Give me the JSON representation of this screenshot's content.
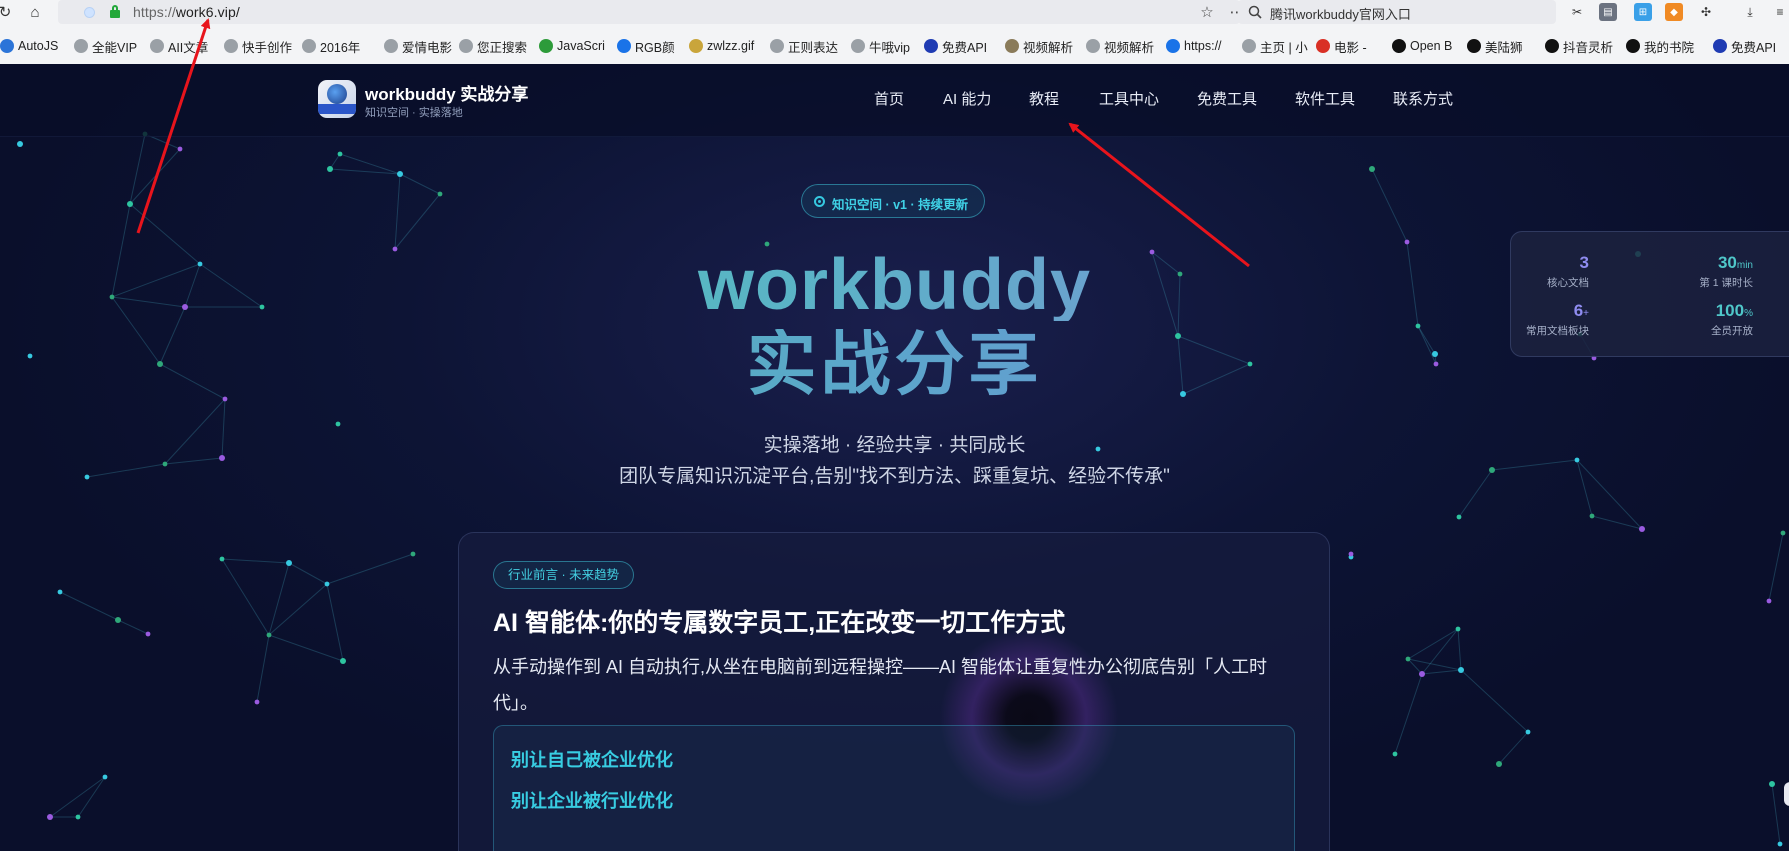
{
  "browser": {
    "url_scheme": "https://",
    "url_host": "work6.vip/",
    "search_text": "腾讯workbuddy官网入口",
    "icons": {
      "back": "back-icon",
      "home": "home-icon",
      "site": "site-info-icon",
      "lock": "lock-icon",
      "star": "bookmark-star-icon",
      "more": "more-icon",
      "dropdown": "chevron-down-icon",
      "search": "search-icon",
      "scissors": "scissors-icon",
      "extensions": "puzzle-icon",
      "download": "download-icon",
      "menu": "menu-icon"
    },
    "bookmarks": [
      "AutoJS",
      "全能VIP",
      "AII文章",
      "快手创作",
      "2016年",
      "爱情电影",
      "您正搜索",
      "JavaScri",
      "RGB颜",
      "zwlzz.gif",
      "正则表达",
      "牛哦vip",
      "免费API",
      "视频解析",
      "视频解析",
      "https://",
      "主页 | 小",
      "电影 -",
      "Open B",
      "美陆狮",
      "抖音灵析",
      "我的书院",
      "免费API"
    ]
  },
  "site": {
    "brand_title": "workbuddy 实战分享",
    "brand_subtitle": "知识空间 · 实操落地",
    "nav": [
      "首页",
      "AI 能力",
      "教程",
      "工具中心",
      "免费工具",
      "软件工具",
      "联系方式"
    ],
    "badge": "知识空间 · v1 · 持续更新",
    "hero_line1": "workbuddy",
    "hero_line2": "实战分享",
    "tagline1": "实操落地 · 经验共享 · 共同成长",
    "tagline2": "团队专属知识沉淀平台,告别\"找不到方法、踩重复坑、经验不传承\"",
    "card": {
      "chip": "行业前言 · 未来趋势",
      "title": "AI 智能体:你的专属数字员工,正在改变一切工作方式",
      "desc": "从手动操作到 AI 自动执行,从坐在电脑前到远程操控——AI 智能体让重复性办公彻底告别「人工时代」。",
      "points": [
        "别让自己被企业优化",
        "别让企业被行业优化"
      ]
    },
    "stats": [
      {
        "value": "3",
        "unit": "",
        "label": "核心文档"
      },
      {
        "value": "30",
        "unit": "min",
        "label": "第 1 课时长"
      },
      {
        "value": "6",
        "unit": "+",
        "label": "常用文档板块"
      },
      {
        "value": "100",
        "unit": "%",
        "label": "全员开放"
      }
    ]
  },
  "colors": {
    "accent_teal": "#38cde2",
    "hero_gradient_start": "#44c9a6",
    "hero_gradient_end": "#8c7bde",
    "annotation_arrow": "#e8141c",
    "stat_purple": "#8f8cf0",
    "stat_teal": "#4fc7c9"
  }
}
